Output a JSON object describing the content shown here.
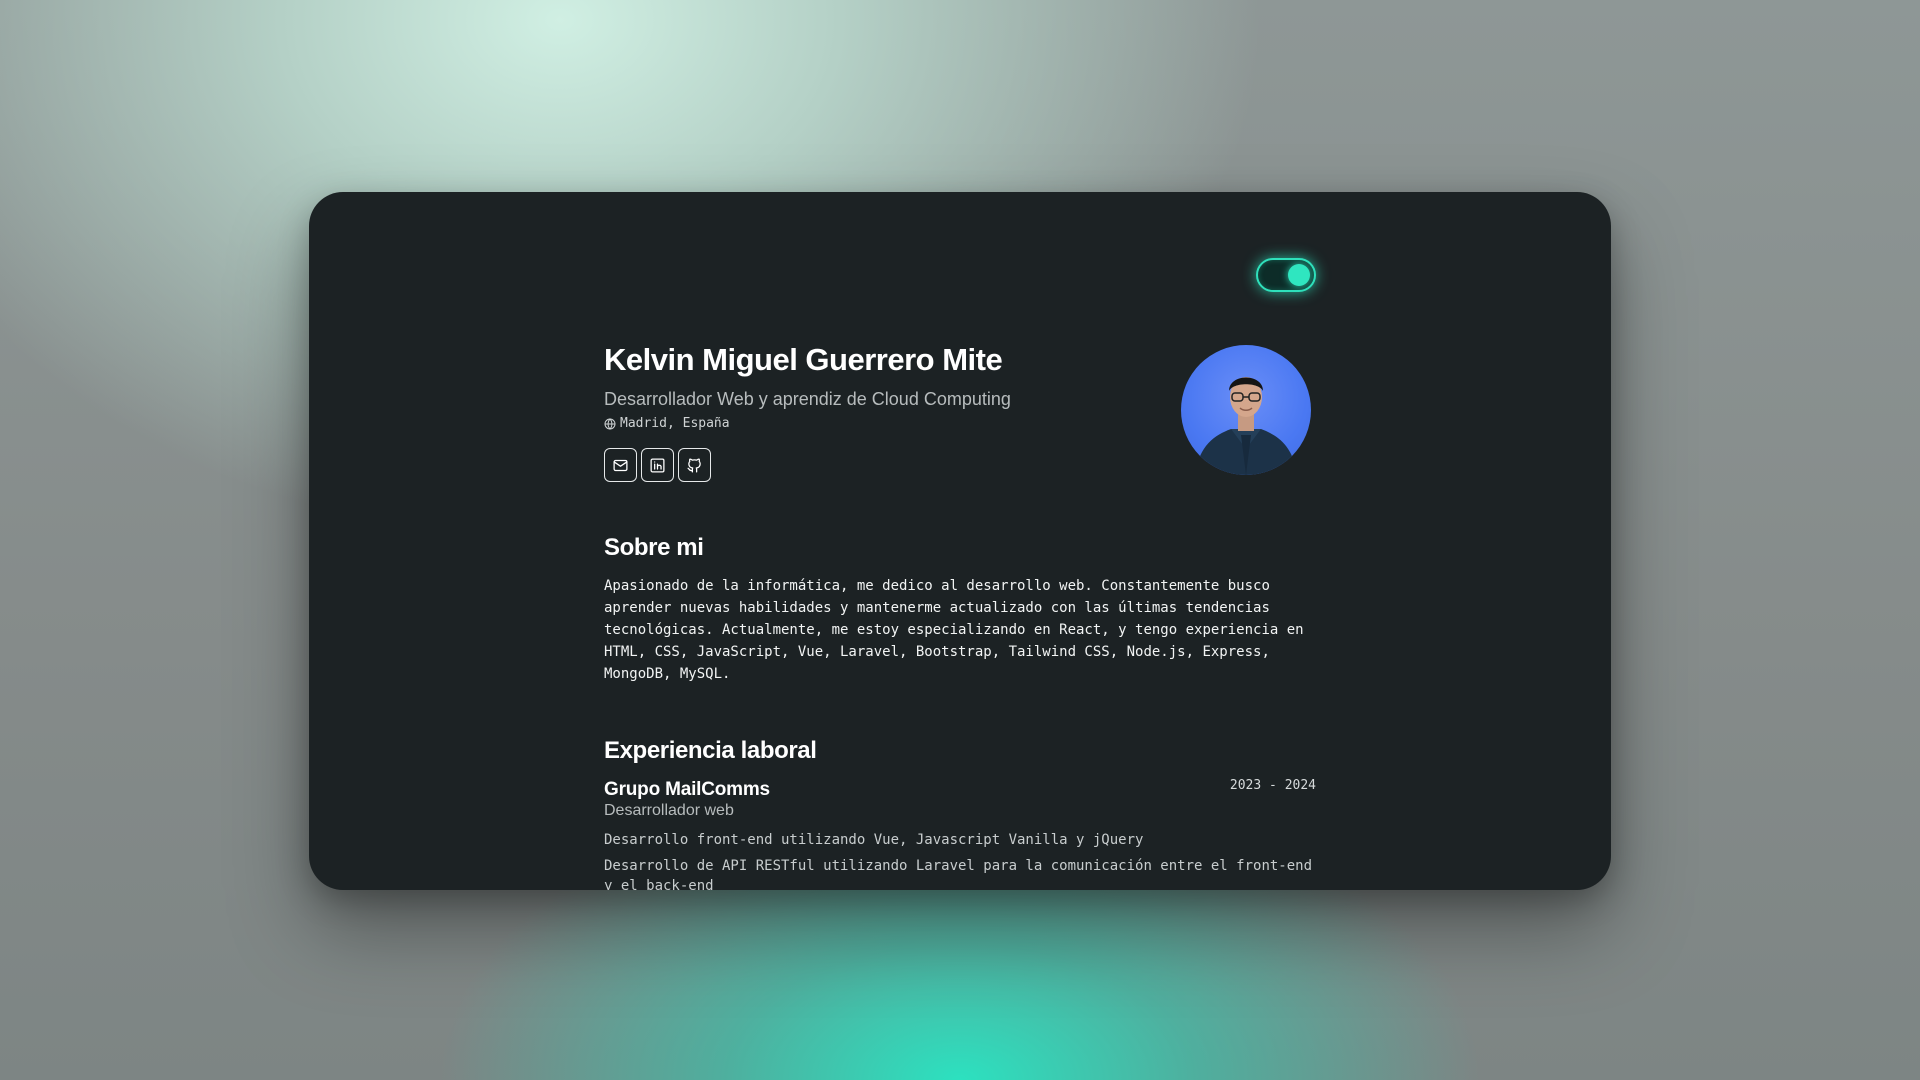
{
  "theme": {
    "accent": "#2fe0bb",
    "card_background": "#1c2224",
    "avatar_background": "#4a78f2",
    "dark_mode_enabled": true
  },
  "profile": {
    "name": "Kelvin Miguel Guerrero Mite",
    "role": "Desarrollador Web y aprendiz de Cloud Computing",
    "location": "Madrid, España",
    "socials": [
      {
        "icon": "mail-icon"
      },
      {
        "icon": "linkedin-icon"
      },
      {
        "icon": "github-icon"
      }
    ]
  },
  "about": {
    "title": "Sobre mi",
    "text": "Apasionado de la informática, me dedico al desarrollo web. Constantemente busco aprender nuevas habilidades y mantenerme actualizado con las últimas tendencias tecnológicas. Actualmente, me estoy especializando en React, y tengo experiencia en HTML, CSS, JavaScript, Vue, Laravel, Bootstrap, Tailwind CSS, Node.js, Express, MongoDB, MySQL."
  },
  "experience": {
    "title": "Experiencia laboral",
    "items": [
      {
        "company": "Grupo MailComms",
        "position": "Desarrollador web",
        "years": "2023 - 2024",
        "tasks": [
          "Desarrollo front-end utilizando Vue, Javascript Vanilla y jQuery",
          "Desarrollo de API RESTful utilizando Laravel para la comunicación entre el front-end y el back-end"
        ]
      }
    ]
  }
}
